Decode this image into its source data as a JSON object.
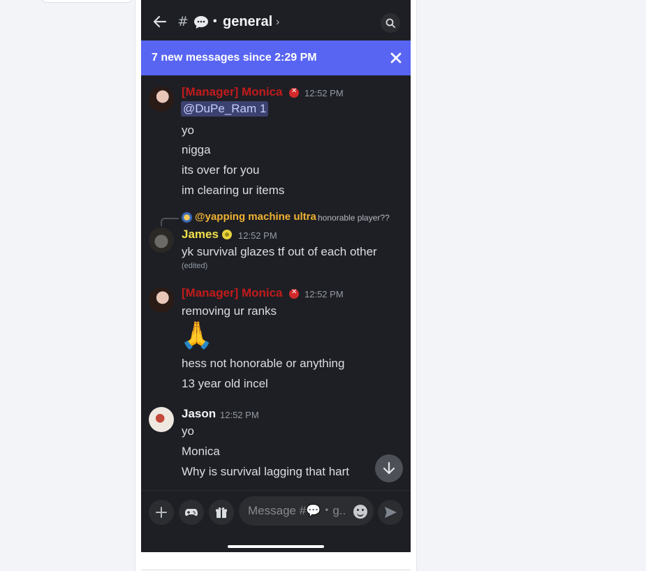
{
  "header": {
    "hash_glyph": "#",
    "separator": "•",
    "channel_name": "general",
    "chevron": "›"
  },
  "banner": {
    "text": "7 new messages since 2:29 PM"
  },
  "messages": [
    {
      "author": "[Manager] Monica",
      "time": "12:52 PM",
      "mention": "@DuPe_Ram 1",
      "lines": [
        "yo",
        "nigga",
        "its over for you",
        "im clearing ur items"
      ]
    },
    {
      "reply_to": {
        "author": "@yapping machine ultra",
        "text": "honorable player??"
      },
      "author": "James",
      "time": "12:52 PM",
      "lines": [
        "yk survival glazes tf out of each other"
      ],
      "edited": "(edited)"
    },
    {
      "author": "[Manager] Monica",
      "time": "12:52 PM",
      "lines": [
        "removing ur ranks",
        "hess not honorable or anything",
        "13 year old incel"
      ],
      "emoji": "🙏"
    },
    {
      "author": "Jason",
      "time": "12:52 PM",
      "lines": [
        "yo",
        "Monica",
        "Why is survival lagging that hart"
      ]
    }
  ],
  "composer": {
    "placeholder": "Message #💬・g.."
  },
  "icons": {
    "back": "arrow-left-icon",
    "channel": "speech-bubble-icon",
    "search": "search-icon",
    "close": "close-icon",
    "jump": "arrow-down-icon",
    "plus": "plus-icon",
    "games": "gamepad-icon",
    "gift": "gift-icon",
    "emoji": "emoji-icon",
    "send": "send-icon"
  },
  "colors": {
    "background": "#1e1f25",
    "banner": "#5865f2",
    "manager_role": "#c21b1b",
    "james_name": "#f1e04a",
    "reply_name": "#f0b232",
    "mention_bg": "#3c4270"
  }
}
